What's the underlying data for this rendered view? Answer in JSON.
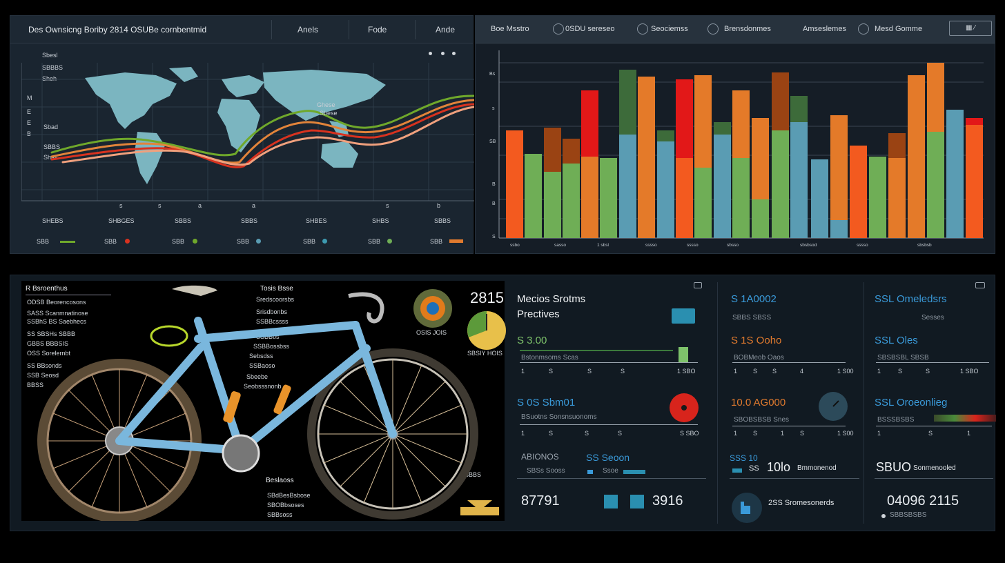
{
  "top_left": {
    "title": "Des Ownsicng Boriby 2814  OSUBe cornbentmid",
    "tabs": [
      "Anels",
      "Fode",
      "Ande"
    ],
    "y_labels": [
      "Sbesl",
      "SBBBS",
      "Sheh",
      "Sbad",
      "SBBS",
      "Shas"
    ],
    "y_ticks": [
      "M",
      "E",
      "E",
      "B"
    ],
    "map_annotation": [
      "Ghese",
      "Sbese"
    ],
    "x_ticks": [
      "s",
      "s",
      "a",
      "a",
      "s",
      "b"
    ],
    "bottom_labels": [
      "SHEBS",
      "SHBGES",
      "SBBS",
      "SBBS",
      "SHBES",
      "SHBS",
      "SBBS"
    ],
    "controls": [
      "SBB",
      "SBB",
      "SBB",
      "SBB",
      "SBB",
      "SBB",
      "SBB"
    ],
    "line_colors": [
      "#6fa82b",
      "#e2843a",
      "#d8321f",
      "#f0a07d"
    ]
  },
  "top_right": {
    "nav": [
      "Boe Msstro",
      "0SDU sereseo",
      "Seociemss",
      "Brensdonmes",
      "Amseslemes",
      "Mesd Gomme"
    ],
    "button": "",
    "y_ticks": [
      "Bs",
      "s",
      "SB",
      "B",
      "B",
      "S"
    ],
    "x_ticks": [
      "ssbo",
      "sasso",
      "1 sbsl",
      "sssso",
      "sssso",
      "sbsso",
      "sbsbsod",
      "sssso",
      "sbsbsb"
    ],
    "palette": [
      "#f35a1f",
      "#6fae56",
      "#e47a29",
      "#5a9cb3",
      "#9a4313",
      "#e21818",
      "#3d6b3a"
    ]
  },
  "bike_panel": {
    "title": "R Bsroenthus",
    "sub_labels": [
      "ODSB Beorencosons",
      "SASS Scanmnatinose",
      "SSBhS BS Saebhecs",
      "SS SBSHs SBBB",
      "GBBS BBBSIS",
      "OSS Sorelernbt",
      "SS BBsonds",
      "SSB Seosd",
      "BBSS"
    ],
    "right_title": "Tosis Bsse",
    "right_labels": [
      "Sredscoorsbs",
      "Srisdbonbs",
      "SSBBcssss",
      "SSBBbs",
      "SSBBossbss",
      "Sebsdss",
      "SSBaoso",
      "Sbeebe",
      "Seobsssnonb"
    ],
    "callout_labels": [
      "Beslaoss",
      "SBdBesBsbose",
      "SBOBbsoses",
      "SBBsoss"
    ],
    "year": "2815",
    "gauge_caption": "OSIS JOIS",
    "gauge2_caption": "SBSIY HOIS",
    "right_caption": "BSBBS"
  },
  "metrics": {
    "col1": {
      "title1": "Mecios Srotms",
      "title2": "Prectives",
      "v1": "S 3.00",
      "v1_sub": "Bstonmsoms Scas",
      "v1_ticks": [
        "1",
        "S",
        "S",
        "S",
        "1 SBO"
      ],
      "v2": "S 0S Sbm01",
      "v2_sub": "BSuotns Sonsnsuonoms",
      "v2_ticks": [
        "1",
        "S",
        "S",
        "S",
        "S SBO"
      ],
      "v3_label": "ABIONOS",
      "v3": "SS Seoon",
      "v3_sub": "SBSs Sooss",
      "v3_sub2": "Ssoe",
      "num1": "87791",
      "num2": "3916"
    },
    "col2": {
      "title": "S 1A0002",
      "subtitle": "SBBS SBSS",
      "v1": "S 1S Ooho",
      "v1_sub": "BOBMeob Oaos",
      "v1_ticks": [
        "1",
        "S",
        "S",
        "4",
        "1 S00"
      ],
      "v2": "10.0 AG000",
      "v2_sub": "SBOBSBSB Snes",
      "v2_ticks": [
        "1",
        "S",
        "1",
        "S",
        "1 S00"
      ],
      "v3a": "SSS 10",
      "v3b": "SS",
      "v3c": "10lo",
      "v3d": "Bmmonenod",
      "v4": "2SS Sromesonerds"
    },
    "col3": {
      "title": "SSL Omeledsrs",
      "subtitle": "Sesses",
      "v1": "SSL Oles",
      "v1_sub": "SBSBSBL SBSB",
      "v1_ticks": [
        "1",
        "S",
        "S",
        "1 SBO"
      ],
      "v2": "SSL Oroeonlieg",
      "v2_sub": "BSSSBSBS",
      "v2_ticks": [
        "1",
        "S",
        "1"
      ],
      "v3a": "SBUO",
      "v3b": "Sonmenooled",
      "num": "04096 2115",
      "num_sub": "SBBSBSBS"
    }
  },
  "colors": {
    "accent_blue": "#3a9ad9",
    "accent_orange": "#e07a2e",
    "accent_green": "#7ec36b",
    "accent_red": "#d8241c"
  }
}
